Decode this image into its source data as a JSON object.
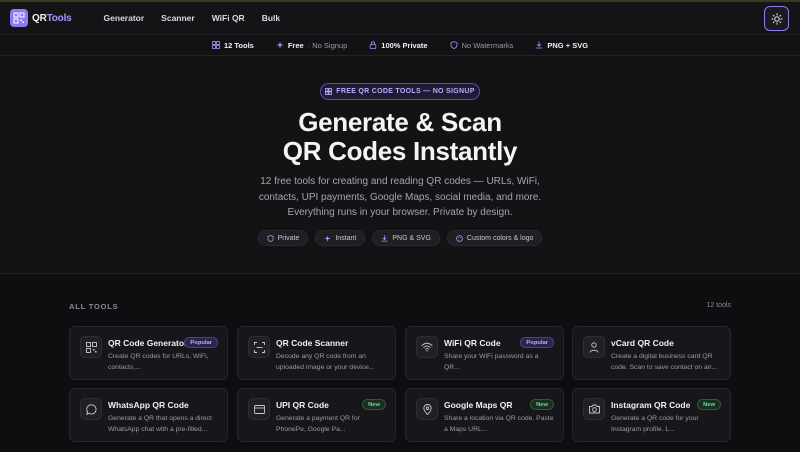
{
  "header": {
    "logo_prefix": "QR",
    "logo_suffix": "Tools",
    "nav": [
      "Generator",
      "Scanner",
      "WiFi QR",
      "Bulk"
    ],
    "accent": "#8b7cf6"
  },
  "strip": {
    "items": [
      {
        "icon": "grid-icon",
        "bold": "12 Tools",
        "rest": ""
      },
      {
        "icon": "sparkle-icon",
        "bold": "Free",
        "rest": " · No Signup"
      },
      {
        "icon": "lock-icon",
        "bold": "100% Private",
        "rest": ""
      },
      {
        "icon": "shield-icon",
        "bold": "",
        "rest": "No Watermarks"
      },
      {
        "icon": "download-icon",
        "bold": "PNG + SVG",
        "rest": ""
      }
    ]
  },
  "hero": {
    "badge": "FREE QR CODE TOOLS — NO SIGNUP",
    "title_line1": "Generate & Scan",
    "title_line2": "QR Codes Instantly",
    "subtitle": "12 free tools for creating and reading QR codes — URLs, WiFi, contacts, UPI payments, Google Maps, social media, and more. Everything runs in your browser. Private by design.",
    "chips": [
      {
        "icon": "shield-icon",
        "label": "Private"
      },
      {
        "icon": "sparkle-icon",
        "label": "Instant"
      },
      {
        "icon": "download-icon",
        "label": "PNG & SVG"
      },
      {
        "icon": "palette-icon",
        "label": "Custom colors & logo"
      }
    ]
  },
  "tools": {
    "label": "ALL TOOLS",
    "count": "12 tools",
    "cards": [
      {
        "title": "QR Code Generator",
        "desc": "Create QR codes for URLs, WiFi, contacts,...",
        "tag": "Popular",
        "icon": "qr-icon"
      },
      {
        "title": "QR Code Scanner",
        "desc": "Decode any QR code from an uploaded image or your device...",
        "tag": "",
        "icon": "scan-icon"
      },
      {
        "title": "WiFi QR Code",
        "desc": "Share your WiFi password as a QR...",
        "tag": "Popular",
        "icon": "wifi-icon"
      },
      {
        "title": "vCard QR Code",
        "desc": "Create a digital business card QR code. Scan to save contact on an...",
        "tag": "",
        "icon": "person-icon"
      },
      {
        "title": "WhatsApp QR Code",
        "desc": "Generate a QR that opens a direct WhatsApp chat with a pre-filled...",
        "tag": "",
        "icon": "chat-icon"
      },
      {
        "title": "UPI QR Code",
        "desc": "Generate a payment QR for PhonePe, Google Pa...",
        "tag": "New",
        "icon": "card-icon"
      },
      {
        "title": "Google Maps QR",
        "desc": "Share a location via QR code. Paste a Maps URL...",
        "tag": "New",
        "icon": "pin-icon"
      },
      {
        "title": "Instagram QR Code",
        "desc": "Generate a QR code for your Instagram profile. L...",
        "tag": "New",
        "icon": "camera-icon"
      }
    ]
  }
}
